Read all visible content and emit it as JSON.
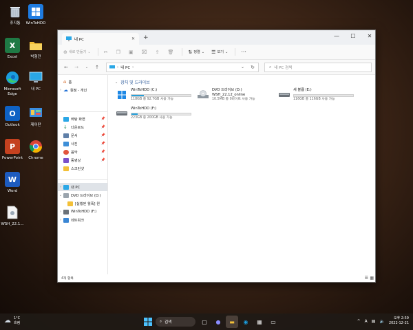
{
  "desktop": {
    "icons": [
      {
        "label": "휴지통",
        "icon": "recycle-bin-icon"
      },
      {
        "label": "WinToHDD",
        "icon": "wintohdd-icon"
      },
      {
        "label": "Excel",
        "icon": "excel-icon"
      },
      {
        "label": "박형전",
        "icon": "folder-icon"
      },
      {
        "label": "Microsoft Edge",
        "icon": "edge-icon"
      },
      {
        "label": "내 PC",
        "icon": "monitor-icon"
      },
      {
        "label": "Outlook",
        "icon": "outlook-icon"
      },
      {
        "label": "제어판",
        "icon": "control-panel-icon"
      },
      {
        "label": "PowerPoint",
        "icon": "powerpoint-icon"
      },
      {
        "label": "Chrome",
        "icon": "chrome-icon"
      },
      {
        "label": "Word",
        "icon": "word-icon"
      },
      {
        "label": "WSH_22.1...",
        "icon": "file-icon"
      }
    ]
  },
  "window": {
    "tab_title": "내 PC",
    "toolbar": {
      "new_label": "새로 만들기",
      "sort_label": "정렬",
      "view_label": "보기",
      "more_label": "···"
    },
    "address": {
      "path": "내 PC",
      "search_placeholder": "내 PC 검색"
    },
    "nav": {
      "home": "홈",
      "onedrive": "원정 - 개인",
      "quick": [
        {
          "label": "바탕 화면"
        },
        {
          "label": "다운로드"
        },
        {
          "label": "문서"
        },
        {
          "label": "사진"
        },
        {
          "label": "음악"
        },
        {
          "label": "동영상"
        },
        {
          "label": "스크린샷"
        }
      ],
      "tree": [
        {
          "label": "내 PC"
        },
        {
          "label": "DVD 드라이브 (D:)"
        },
        {
          "label": "[실행된 월폭] 윈"
        },
        {
          "label": "WinToHDD (F:)"
        },
        {
          "label": "네트워크"
        }
      ]
    },
    "group_title": "장치 및 드라이브",
    "drives": [
      {
        "name": "WinToHDD (C:)",
        "capacity": "118GB 중 92.7GB 사용 가능",
        "used_pct": 21,
        "icon": "windows-drive-icon"
      },
      {
        "name": "DVD 드라이브 (D:)",
        "name2": "WSH_22.12_online",
        "capacity": "10.5MB 중 0바이트 사용 가능",
        "used_pct": 100,
        "icon": "dvd-drive-icon"
      },
      {
        "name": "새 볼륨 (E:)",
        "capacity": "116GB 중 116GB 사용 가능",
        "used_pct": 0,
        "icon": "hard-drive-icon"
      },
      {
        "name": "WinToHDD (F:)",
        "capacity": "223GB 중 200GB 사용 가능",
        "used_pct": 10,
        "icon": "hard-drive-icon"
      }
    ],
    "status": "4개 항목"
  },
  "taskbar": {
    "weather_temp": "1°C",
    "weather_desc": "흐림",
    "search_label": "검색",
    "ime": "A",
    "time": "오후 2:59",
    "date": "2022-12-21"
  },
  "colors": {
    "accent": "#26a0da",
    "group_title": "#2d5a9a"
  }
}
